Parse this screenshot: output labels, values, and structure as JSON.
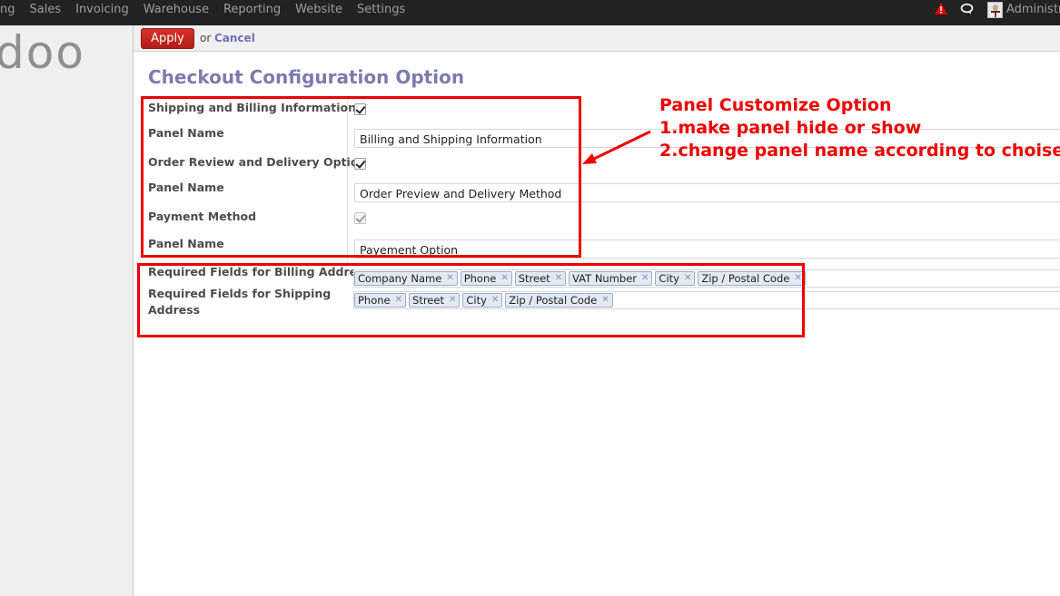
{
  "topbar": {
    "menu": [
      "ng",
      "Sales",
      "Invoicing",
      "Warehouse",
      "Reporting",
      "Website",
      "Settings"
    ],
    "user_name": "Administra",
    "icons": [
      "warning-icon",
      "chat-icon"
    ]
  },
  "sidebar": {
    "logo": "doo"
  },
  "actions": {
    "apply": "Apply",
    "or": "or",
    "cancel": "Cancel"
  },
  "form": {
    "title": "Checkout Configuration Option",
    "shipping_billing": {
      "label": "Shipping and Billing Information",
      "checked": true
    },
    "panel1": {
      "label": "Panel Name",
      "value": "Billing and Shipping Information"
    },
    "order_review": {
      "label": "Order Review and Delivery Option",
      "checked": true
    },
    "panel2": {
      "label": "Panel Name",
      "value": "Order Preview and Delivery Method"
    },
    "payment_method": {
      "label": "Payment Method",
      "checked": true,
      "disabled": true
    },
    "panel3": {
      "label": "Panel Name",
      "value": "Payement Option"
    },
    "billing_required": {
      "label": "Required Fields for Billing Address",
      "tags": [
        "Company Name",
        "Phone",
        "Street",
        "VAT Number",
        "City",
        "Zip / Postal Code"
      ]
    },
    "shipping_required": {
      "label_line1": "Required Fields for Shipping",
      "label_line2": "Address",
      "tags": [
        "Phone",
        "Street",
        "City",
        "Zip / Postal Code"
      ]
    }
  },
  "annotation": {
    "title": "Panel Customize Option",
    "line1": "1.make panel hide or show",
    "line2": "2.change panel name according to choise",
    "color": "#ee0000"
  },
  "colors": {
    "topbar": "#222222",
    "title": "#7c7bad",
    "apply": "#c9241f",
    "annotation": "#ee0000"
  }
}
